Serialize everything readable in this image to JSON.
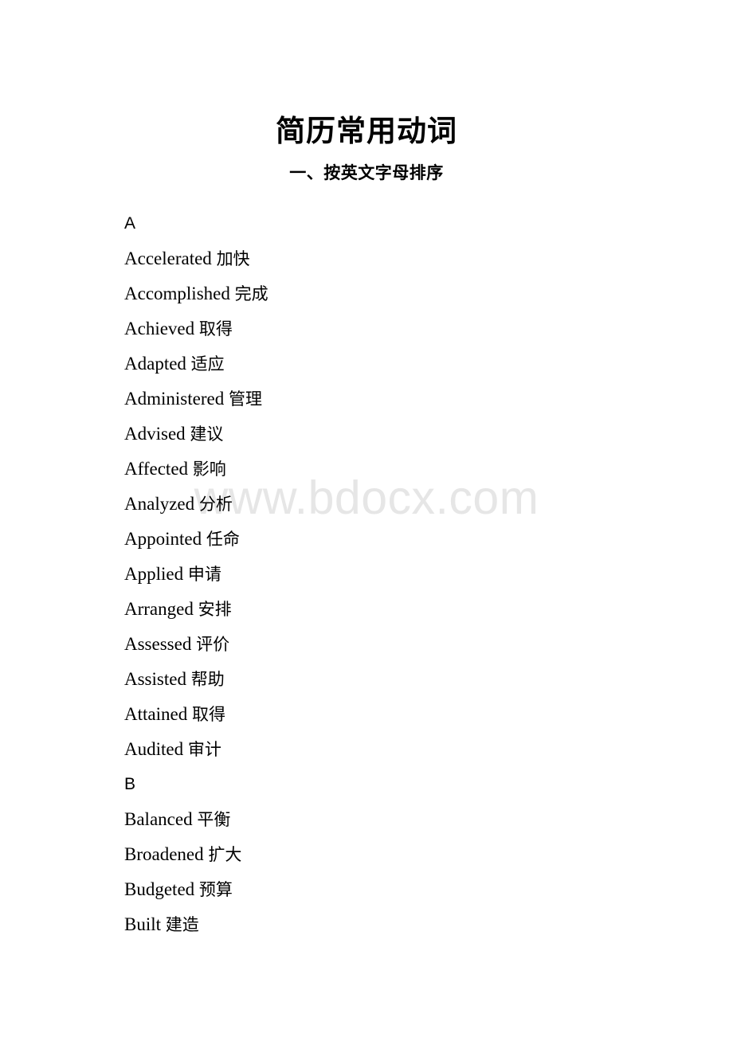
{
  "document": {
    "title": "简历常用动词",
    "subtitle": "一、按英文字母排序",
    "watermark": "www.bdocx.com",
    "watermark_color": "#e6e6e6",
    "background_color": "#ffffff",
    "text_color": "#000000"
  },
  "entries": [
    {
      "kind": "section",
      "en": "A",
      "cn": ""
    },
    {
      "kind": "verb",
      "en": "Accelerated",
      "cn": "加快"
    },
    {
      "kind": "verb",
      "en": "Accomplished",
      "cn": "完成"
    },
    {
      "kind": "verb",
      "en": "Achieved",
      "cn": "取得"
    },
    {
      "kind": "verb",
      "en": "Adapted",
      "cn": "适应"
    },
    {
      "kind": "verb",
      "en": "Administered",
      "cn": "管理"
    },
    {
      "kind": "verb",
      "en": "Advised",
      "cn": "建议"
    },
    {
      "kind": "verb",
      "en": "Affected",
      "cn": "影响"
    },
    {
      "kind": "verb",
      "en": "Analyzed",
      "cn": "分析"
    },
    {
      "kind": "verb",
      "en": "Appointed",
      "cn": "任命"
    },
    {
      "kind": "verb",
      "en": "Applied",
      "cn": "申请"
    },
    {
      "kind": "verb",
      "en": "Arranged",
      "cn": "安排"
    },
    {
      "kind": "verb",
      "en": "Assessed",
      "cn": "评价"
    },
    {
      "kind": "verb",
      "en": "Assisted",
      "cn": "帮助"
    },
    {
      "kind": "verb",
      "en": "Attained",
      "cn": "取得"
    },
    {
      "kind": "verb",
      "en": "Audited",
      "cn": "审计"
    },
    {
      "kind": "section",
      "en": "B",
      "cn": ""
    },
    {
      "kind": "verb",
      "en": "Balanced",
      "cn": "平衡"
    },
    {
      "kind": "verb",
      "en": "Broadened",
      "cn": "扩大"
    },
    {
      "kind": "verb",
      "en": "Budgeted",
      "cn": "预算"
    },
    {
      "kind": "verb",
      "en": "Built",
      "cn": "建造"
    }
  ]
}
